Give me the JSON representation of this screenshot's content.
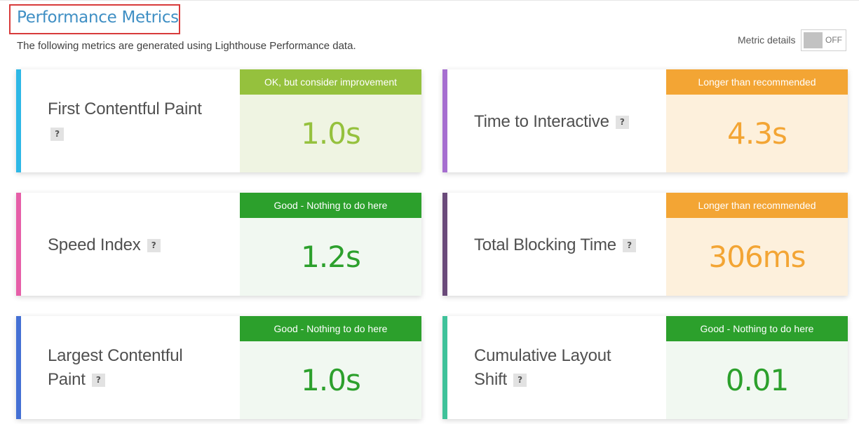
{
  "page": {
    "title": "Performance Metrics",
    "subtitle": "The following metrics are generated using Lighthouse Performance data.",
    "metric_details_label": "Metric details",
    "metric_details_toggle": "OFF",
    "help_icon_text": "?"
  },
  "colors": {
    "title": "#3f8fc4",
    "title_highlight_border": "#d83b3b",
    "status_ok_bg": "#95c13d",
    "status_good_bg": "#2ca02c",
    "status_warn_bg": "#f3a534"
  },
  "metrics": [
    {
      "name": "First Contentful Paint",
      "status": "OK, but consider improvement",
      "value": "1.0s",
      "accent": "#2eb8e6"
    },
    {
      "name": "Time to Interactive",
      "status": "Longer than recommended",
      "value": "4.3s",
      "accent": "#a66ed0"
    },
    {
      "name": "Speed Index",
      "status": "Good - Nothing to do here",
      "value": "1.2s",
      "accent": "#e65fa8"
    },
    {
      "name": "Total Blocking Time",
      "status": "Longer than recommended",
      "value": "306ms",
      "accent": "#6a4a7a"
    },
    {
      "name": "Largest Contentful Paint",
      "status": "Good - Nothing to do here",
      "value": "1.0s",
      "accent": "#4470d4"
    },
    {
      "name": "Cumulative Layout Shift",
      "status": "Good - Nothing to do here",
      "value": "0.01",
      "accent": "#3fc29a"
    }
  ]
}
